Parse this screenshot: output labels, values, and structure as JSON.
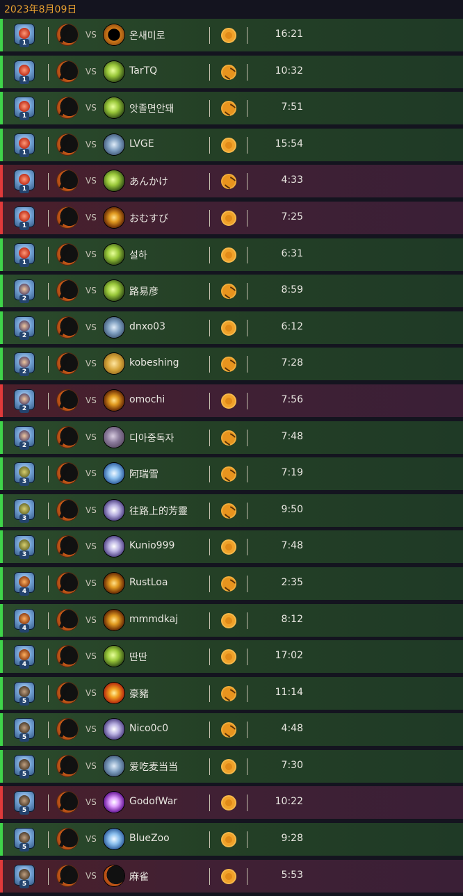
{
  "header": {
    "date": "2023年8月09日"
  },
  "colors": {
    "win_border": "#3fd44a",
    "loss_border": "#e03a3a",
    "date_text": "#e8a030"
  },
  "vs_label": "VS",
  "matches": [
    {
      "result": "win",
      "rank": "1",
      "opponent": "온새미로",
      "opponent_icon": "gold-shield-icon",
      "coin": "plain",
      "time": "16:21"
    },
    {
      "result": "win",
      "rank": "1",
      "opponent": "TarTQ",
      "opponent_icon": "lime-claw-icon",
      "coin": "swirl",
      "time": "10:32"
    },
    {
      "result": "win",
      "rank": "1",
      "opponent": "앗졸면안돼",
      "opponent_icon": "lime-claw-icon",
      "coin": "swirl",
      "time": "7:51"
    },
    {
      "result": "win",
      "rank": "1",
      "opponent": "LVGE",
      "opponent_icon": "silver-chest-icon",
      "coin": "plain",
      "time": "15:54"
    },
    {
      "result": "loss",
      "rank": "1",
      "opponent": "あんかけ",
      "opponent_icon": "lime-claw-icon",
      "coin": "swirl",
      "time": "4:33"
    },
    {
      "result": "loss",
      "rank": "1",
      "opponent": "おむすび",
      "opponent_icon": "fire-skull-icon",
      "coin": "plain",
      "time": "7:25"
    },
    {
      "result": "win",
      "rank": "1",
      "opponent": "설하",
      "opponent_icon": "lime-claw-icon",
      "coin": "plain",
      "time": "6:31"
    },
    {
      "result": "win",
      "rank": "2",
      "opponent": "路易彦",
      "opponent_icon": "lime-claw-icon",
      "coin": "swirl",
      "time": "8:59"
    },
    {
      "result": "win",
      "rank": "2",
      "opponent": "dnxo03",
      "opponent_icon": "silver-chest-icon",
      "coin": "plain",
      "time": "6:12"
    },
    {
      "result": "win",
      "rank": "2",
      "opponent": "kobeshing",
      "opponent_icon": "gold-tome-icon",
      "coin": "swirl",
      "time": "7:28"
    },
    {
      "result": "loss",
      "rank": "2",
      "opponent": "omochi",
      "opponent_icon": "fire-skull-icon",
      "coin": "plain",
      "time": "7:56"
    },
    {
      "result": "win",
      "rank": "2",
      "opponent": "디아중독자",
      "opponent_icon": "stone-demon-icon",
      "coin": "swirl",
      "time": "7:48"
    },
    {
      "result": "win",
      "rank": "3",
      "opponent": "阿瑞雪",
      "opponent_icon": "blue-sword-icon",
      "coin": "swirl",
      "time": "7:19"
    },
    {
      "result": "win",
      "rank": "3",
      "opponent": "往路上的芳靈",
      "opponent_icon": "purple-blade-icon",
      "coin": "swirl",
      "time": "9:50"
    },
    {
      "result": "win",
      "rank": "3",
      "opponent": "Kunio999",
      "opponent_icon": "purple-blade-icon",
      "coin": "plain",
      "time": "7:48"
    },
    {
      "result": "win",
      "rank": "4",
      "opponent": "RustLoa",
      "opponent_icon": "fire-skull-icon",
      "coin": "swirl",
      "time": "2:35"
    },
    {
      "result": "win",
      "rank": "4",
      "opponent": "mmmdkaj",
      "opponent_icon": "fire-skull-icon",
      "coin": "plain",
      "time": "8:12"
    },
    {
      "result": "win",
      "rank": "4",
      "opponent": "딴딴",
      "opponent_icon": "lime-claw-icon",
      "coin": "plain",
      "time": "17:02"
    },
    {
      "result": "win",
      "rank": "5",
      "opponent": "豪豬",
      "opponent_icon": "fire-sword-icon",
      "coin": "swirl",
      "time": "11:14"
    },
    {
      "result": "win",
      "rank": "5",
      "opponent": "Nico0c0",
      "opponent_icon": "purple-blade-icon",
      "coin": "swirl",
      "time": "4:48"
    },
    {
      "result": "win",
      "rank": "5",
      "opponent": "爱吃麦当当",
      "opponent_icon": "silver-chest-icon",
      "coin": "plain",
      "time": "7:30"
    },
    {
      "result": "loss",
      "rank": "5",
      "opponent": "GodofWar",
      "opponent_icon": "violet-burst-icon",
      "coin": "plain",
      "time": "10:22"
    },
    {
      "result": "win",
      "rank": "5",
      "opponent": "BlueZoo",
      "opponent_icon": "blue-sword-icon",
      "coin": "plain",
      "time": "9:28"
    },
    {
      "result": "loss",
      "rank": "5",
      "opponent": "麻雀",
      "opponent_icon": "dark-scythe-icon",
      "coin": "plain",
      "time": "5:53"
    }
  ]
}
